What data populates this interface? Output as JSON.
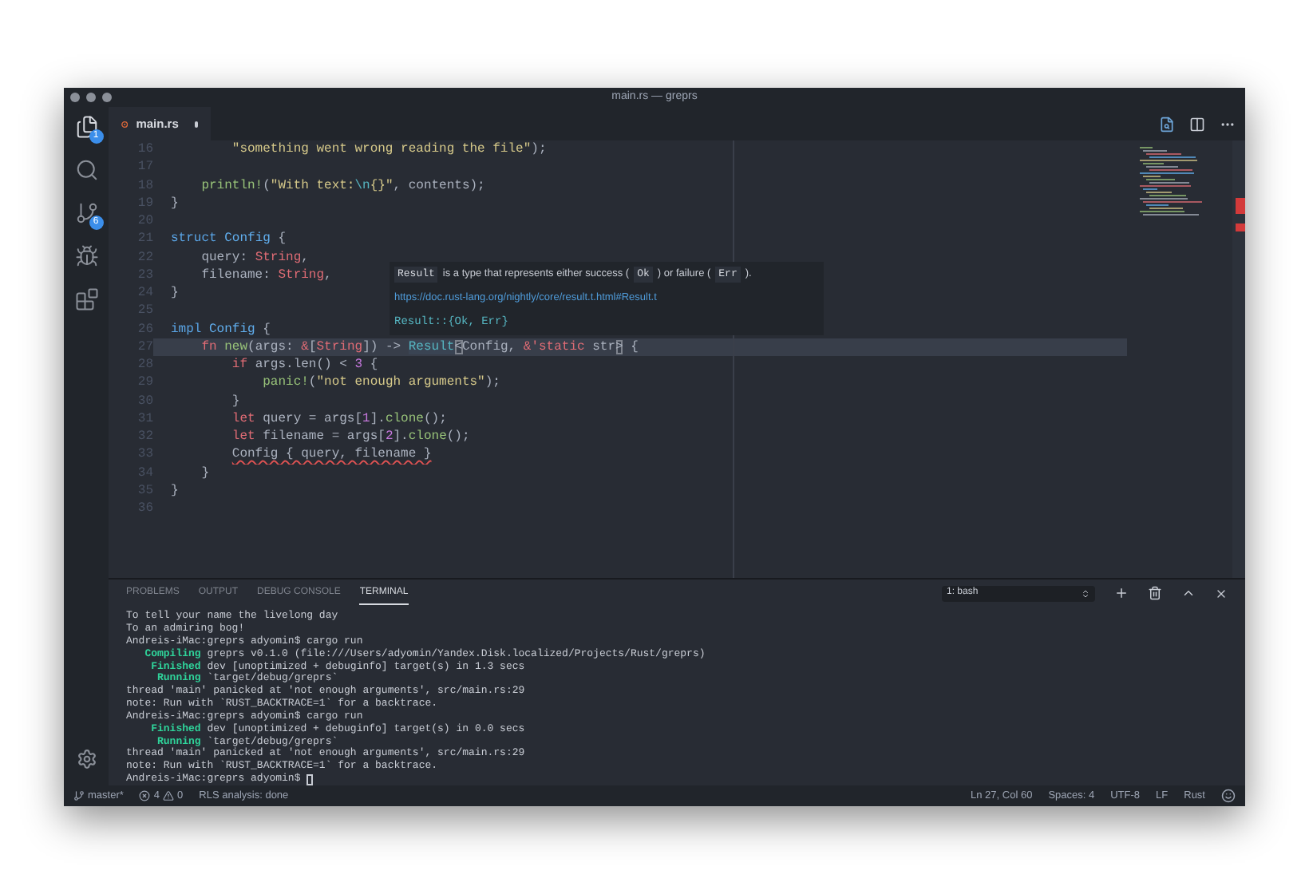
{
  "window": {
    "title": "main.rs — greprs"
  },
  "activity_bar": {
    "items": [
      {
        "kind": "files",
        "badge": "1",
        "selected": true
      },
      {
        "kind": "search",
        "selected": false
      },
      {
        "kind": "scm",
        "badge": "6",
        "selected": false
      },
      {
        "kind": "debug",
        "selected": false
      },
      {
        "kind": "extensions",
        "selected": false
      }
    ]
  },
  "tabs": [
    {
      "label": "main.rs",
      "modified": true,
      "selected": true
    }
  ],
  "editor": {
    "lines": [
      {
        "number": "16",
        "current": false,
        "tokens": [
          {
            "text": "        \"something went wrong reading the file\"",
            "kind": "string"
          },
          {
            "text": ");",
            "kind": "plain"
          }
        ]
      },
      {
        "number": "17",
        "current": false
      },
      {
        "number": "18",
        "current": false,
        "tokens": [
          {
            "text": "    println!",
            "kind": "function"
          },
          {
            "text": "(",
            "kind": "plain"
          },
          {
            "text": "\"With text:",
            "kind": "string"
          },
          {
            "text": "\\n",
            "kind": "escape"
          },
          {
            "text": "{}\"",
            "kind": "string"
          },
          {
            "text": ", contents);",
            "kind": "plain"
          }
        ]
      },
      {
        "number": "19",
        "current": false,
        "tokens": [
          {
            "text": "}",
            "kind": "plain"
          }
        ]
      },
      {
        "number": "20",
        "current": false
      },
      {
        "number": "21",
        "current": false,
        "tokens": [
          {
            "text": "struct",
            "kind": "storage"
          },
          {
            "text": " Config",
            "kind": "type"
          },
          {
            "text": " {",
            "kind": "plain"
          }
        ]
      },
      {
        "number": "22",
        "current": false,
        "tokens": [
          {
            "text": "    query: ",
            "kind": "plain"
          },
          {
            "text": "String",
            "kind": "keyword"
          },
          {
            "text": ",",
            "kind": "plain"
          }
        ]
      },
      {
        "number": "23",
        "current": false,
        "tokens": [
          {
            "text": "    filename: ",
            "kind": "plain"
          },
          {
            "text": "String",
            "kind": "keyword"
          },
          {
            "text": ",",
            "kind": "plain"
          }
        ]
      },
      {
        "number": "24",
        "current": false,
        "tokens": [
          {
            "text": "}",
            "kind": "plain"
          }
        ]
      },
      {
        "number": "25",
        "current": false
      },
      {
        "number": "26",
        "current": false,
        "tokens": [
          {
            "text": "impl",
            "kind": "storage"
          },
          {
            "text": " Config",
            "kind": "type"
          },
          {
            "text": " {",
            "kind": "plain"
          }
        ]
      },
      {
        "number": "27",
        "current": true,
        "tokens": [
          {
            "text": "    fn",
            "kind": "keyword"
          },
          {
            "text": " new",
            "kind": "function"
          },
          {
            "text": "(args: ",
            "kind": "plain"
          },
          {
            "text": "&",
            "kind": "keyword"
          },
          {
            "text": "[",
            "kind": "plain"
          },
          {
            "text": "String",
            "kind": "keyword"
          },
          {
            "text": "]) -> ",
            "kind": "plain"
          },
          {
            "text": "Result",
            "kind": "hovered"
          },
          {
            "text": "<",
            "kind": "bracket"
          },
          {
            "text": "Config, ",
            "kind": "plain"
          },
          {
            "text": "&'static",
            "kind": "keyword"
          },
          {
            "text": " str",
            "kind": "plain"
          },
          {
            "text": ">",
            "kind": "bracket"
          },
          {
            "text": " {",
            "kind": "plain"
          }
        ]
      },
      {
        "number": "28",
        "current": false,
        "tokens": [
          {
            "text": "        if",
            "kind": "keyword"
          },
          {
            "text": " args.len() < ",
            "kind": "plain"
          },
          {
            "text": "3",
            "kind": "number"
          },
          {
            "text": " {",
            "kind": "plain"
          }
        ]
      },
      {
        "number": "29",
        "current": false,
        "tokens": [
          {
            "text": "            panic!",
            "kind": "function"
          },
          {
            "text": "(",
            "kind": "plain"
          },
          {
            "text": "\"not enough arguments\"",
            "kind": "string"
          },
          {
            "text": ");",
            "kind": "plain"
          }
        ]
      },
      {
        "number": "30",
        "current": false,
        "tokens": [
          {
            "text": "        }",
            "kind": "plain"
          }
        ]
      },
      {
        "number": "31",
        "current": false,
        "tokens": [
          {
            "text": "        let",
            "kind": "keyword"
          },
          {
            "text": " query = args[",
            "kind": "plain"
          },
          {
            "text": "1",
            "kind": "number"
          },
          {
            "text": "].",
            "kind": "plain"
          },
          {
            "text": "clone",
            "kind": "function"
          },
          {
            "text": "();",
            "kind": "plain"
          }
        ]
      },
      {
        "number": "32",
        "current": false,
        "tokens": [
          {
            "text": "        let",
            "kind": "keyword"
          },
          {
            "text": " filename = args[",
            "kind": "plain"
          },
          {
            "text": "2",
            "kind": "number"
          },
          {
            "text": "].",
            "kind": "plain"
          },
          {
            "text": "clone",
            "kind": "function"
          },
          {
            "text": "();",
            "kind": "plain"
          }
        ]
      },
      {
        "number": "33",
        "current": false,
        "tokens": [
          {
            "text": "        Config { query, filename }",
            "kind": "error"
          }
        ]
      },
      {
        "number": "34",
        "current": false,
        "tokens": [
          {
            "text": "    }",
            "kind": "plain"
          }
        ]
      },
      {
        "number": "35",
        "current": false,
        "tokens": [
          {
            "text": "}",
            "kind": "plain"
          }
        ]
      },
      {
        "number": "36",
        "current": false
      }
    ]
  },
  "hover": {
    "description": [
      {
        "text": "Result",
        "kind": "code"
      },
      {
        "text": "is a type that represents either success (",
        "kind": "text"
      },
      {
        "text": "Ok",
        "kind": "code"
      },
      {
        "text": ") or failure (",
        "kind": "text"
      },
      {
        "text": "Err",
        "kind": "code"
      },
      {
        "text": ").",
        "kind": "text"
      }
    ],
    "link": "https://doc.rust-lang.org/nightly/core/result.t.html#Result.t",
    "signature": "Result::{Ok, Err}"
  },
  "panel": {
    "tabs": [
      {
        "label": "PROBLEMS",
        "selected": false
      },
      {
        "label": "OUTPUT",
        "selected": false
      },
      {
        "label": "DEBUG CONSOLE",
        "selected": false
      },
      {
        "label": "TERMINAL",
        "selected": true
      }
    ],
    "terminal_select": "1: bash",
    "terminal_lines": [
      [
        {
          "text": "To tell your name the livelong day",
          "kind": "plain"
        }
      ],
      [
        {
          "text": "To an admiring bog!",
          "kind": "plain"
        }
      ],
      [
        {
          "text": "Andreis-iMac:greprs adyomin$ cargo run",
          "kind": "plain"
        }
      ],
      [
        {
          "text": "   Compiling",
          "kind": "status"
        },
        {
          "text": " greprs v0.1.0 (file:///Users/adyomin/Yandex.Disk.localized/Projects/Rust/greprs)",
          "kind": "plain"
        }
      ],
      [
        {
          "text": "    Finished",
          "kind": "status"
        },
        {
          "text": " dev [unoptimized + debuginfo] target(s) in 1.3 secs",
          "kind": "plain"
        }
      ],
      [
        {
          "text": "     Running",
          "kind": "status"
        },
        {
          "text": " `target/debug/greprs`",
          "kind": "plain"
        }
      ],
      [
        {
          "text": "thread 'main' panicked at 'not enough arguments', src/main.rs:29",
          "kind": "plain"
        }
      ],
      [
        {
          "text": "note: Run with `RUST_BACKTRACE=1` for a backtrace.",
          "kind": "plain"
        }
      ],
      [
        {
          "text": "Andreis-iMac:greprs adyomin$ cargo run",
          "kind": "plain"
        }
      ],
      [
        {
          "text": "    Finished",
          "kind": "status"
        },
        {
          "text": " dev [unoptimized + debuginfo] target(s) in 0.0 secs",
          "kind": "plain"
        }
      ],
      [
        {
          "text": "     Running",
          "kind": "status"
        },
        {
          "text": " `target/debug/greprs`",
          "kind": "plain"
        }
      ],
      [
        {
          "text": "thread 'main' panicked at 'not enough arguments', src/main.rs:29",
          "kind": "plain"
        }
      ],
      [
        {
          "text": "note: Run with `RUST_BACKTRACE=1` for a backtrace.",
          "kind": "plain"
        }
      ],
      [
        {
          "text": "Andreis-iMac:greprs adyomin$",
          "kind": "plain"
        },
        {
          "kind": "cursor"
        }
      ]
    ]
  },
  "status_bar": {
    "branch": "master*",
    "errors": "4",
    "warnings": "0",
    "message": "RLS analysis: done",
    "right": [
      "Ln 27, Col 60",
      "Spaces: 4",
      "UTF-8",
      "LF",
      "Rust"
    ]
  }
}
